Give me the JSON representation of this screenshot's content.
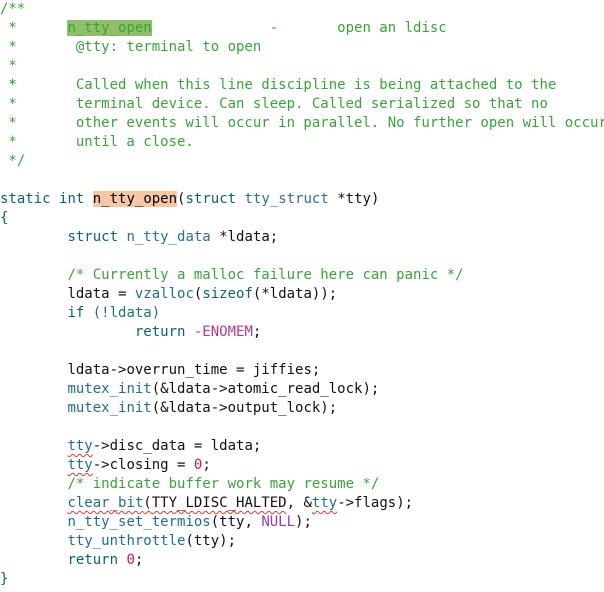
{
  "code": {
    "c1": "/**",
    "c2_star": " *",
    "c2_name": "n_tty_open",
    "c2_sep": "              -       open an ldisc",
    "c3": " *       @tty: terminal to open",
    "c4": " *",
    "c5": " *       Called when this line discipline is being attached to the",
    "c6": " *       terminal device. Can sleep. Called serialized so that no",
    "c7": " *       other events will occur in parallel. No further open will occur",
    "c8": " *       until a close.",
    "c9": " */",
    "sig_static": "static",
    "sig_int": "int",
    "sig_name": "n_tty_open",
    "sig_paren": "(",
    "sig_struct": "struct",
    "sig_type": "tty_struct",
    "sig_rest": " *tty)",
    "brace_open": "{",
    "decl_struct": "struct",
    "decl_type": "n_tty_data",
    "decl_rest": " *ldata;",
    "cmt_malloc": "/* Currently a malloc failure here can panic */",
    "l_ldata_a": "ldata = ",
    "l_vzalloc": "vzalloc",
    "l_vzalloc_b": "(",
    "l_sizeof": "sizeof",
    "l_vzalloc_c": "(*ldata));",
    "l_if": "if",
    "l_if_rest": " (!ldata)",
    "l_return": "return",
    "l_enomem": " -ENOMEM",
    "l_enomem_semi": ";",
    "l_overrun": "ldata->overrun_time = jiffies;",
    "l_mutex1_fn": "mutex_init",
    "l_mutex1_rest": "(&ldata->atomic_read_lock);",
    "l_mutex2_fn": "mutex_init",
    "l_mutex2_rest": "(&ldata->output_lock);",
    "l_tty1": "tty",
    "l_disc": "->disc_data = ldata;",
    "l_tty2": "tty",
    "l_closing_a": "->closing = ",
    "l_closing_num": "0",
    "l_closing_b": ";",
    "cmt_indicate": "/* indicate buffer work may resume */",
    "l_clear_fn": "clear_bit",
    "l_clear_p": "(",
    "l_clear_arg": "TTY_LDISC_HALTED",
    "l_clear_c": ", &",
    "l_clear_tty": "tty",
    "l_clear_rest": "->flags);",
    "l_termios_fn": "n_tty_set_termios",
    "l_termios_a": "(tty, ",
    "l_termios_null": "NULL",
    "l_termios_b": ");",
    "l_unthrottle_fn": "tty_unthrottle",
    "l_unthrottle_rest": "(tty);",
    "l_ret2": "return",
    "l_ret2_sp": " ",
    "l_ret2_num": "0",
    "l_ret2_semi": ";",
    "brace_close": "}"
  },
  "colors": {
    "comment": "#3aa33a",
    "keyword": "#0b5f7a",
    "type": "#2e6e9e",
    "function_highlight": "#f7c6a3",
    "comment_highlight": "#8fbf6a",
    "number": "#c2185b",
    "error_squiggle": "#e53935"
  }
}
